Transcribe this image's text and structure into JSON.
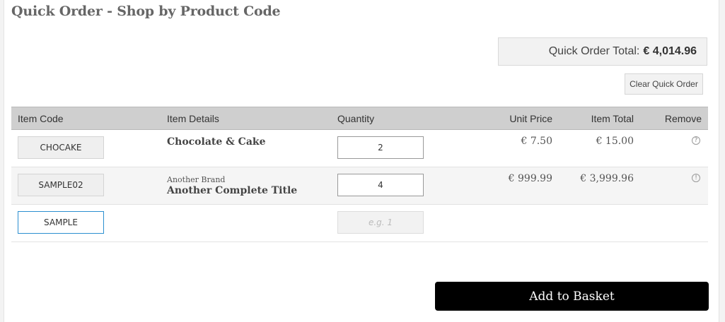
{
  "page": {
    "title": "Quick Order - Shop by Product Code"
  },
  "summary": {
    "total_label": "Quick Order Total:",
    "total_value": "€ 4,014.96",
    "clear_label": "Clear Quick Order"
  },
  "table": {
    "headers": {
      "code": "Item Code",
      "details": "Item Details",
      "quantity": "Quantity",
      "unit_price": "Unit Price",
      "item_total": "Item Total",
      "remove": "Remove"
    },
    "rows": [
      {
        "code": "CHOCAKE",
        "brand": "",
        "title": "Chocolate & Cake",
        "quantity": "2",
        "unit_price": "€ 7.50",
        "item_total": "€ 15.00",
        "remove_icon": "remove-icon"
      },
      {
        "code": "SAMPLE02",
        "brand": "Another Brand",
        "title": "Another Complete Title",
        "quantity": "4",
        "unit_price": "€ 999.99",
        "item_total": "€ 3,999.96",
        "remove_icon": "remove-icon"
      }
    ],
    "new_row": {
      "code_value": "SAMPLE",
      "quantity_placeholder": "e.g. 1"
    }
  },
  "actions": {
    "add_to_basket": "Add to Basket"
  },
  "colors": {
    "header_bg": "#cfcfcf",
    "accent_border": "#2b8fd0",
    "button_bg": "#000000"
  }
}
